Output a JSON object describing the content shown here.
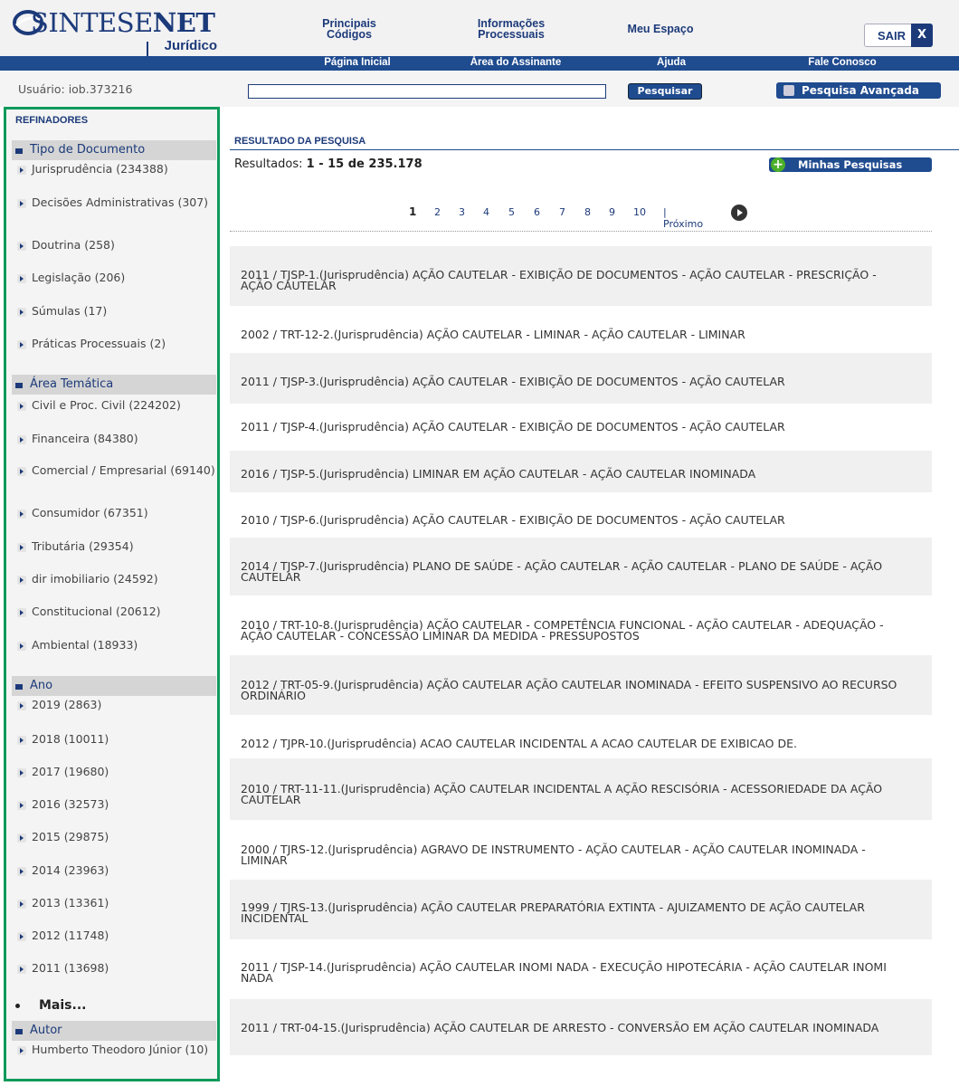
{
  "logo": {
    "brand_a": "SINTESE",
    "brand_b": "NET",
    "sub": "Jurídico"
  },
  "topnav": [
    {
      "label": "Principais Códigos"
    },
    {
      "label": "Informações Processuais"
    },
    {
      "label": "Meu Espaço"
    }
  ],
  "sair": {
    "label": "SAIR",
    "close": "X"
  },
  "subnav": [
    "Página Inicial",
    "Área do Assinante",
    "Ajuda",
    "Fale Conosco"
  ],
  "user": {
    "label": "Usuário: iob.373216"
  },
  "search": {
    "value": "",
    "button": "Pesquisar",
    "advanced": "Pesquisa Avançada"
  },
  "sidebar": {
    "title": "REFINADORES",
    "tipo": {
      "title": "Tipo de Documento",
      "items": [
        "Jurisprudência (234388)",
        "Decisões Administrativas (307)",
        "Doutrina (258)",
        "Legislação (206)",
        "Súmulas (17)",
        "Práticas Processuais (2)"
      ]
    },
    "area": {
      "title": "Área Temática",
      "items": [
        "Civil e Proc. Civil (224202)",
        "Financeira (84380)",
        "Comercial / Empresarial (69140)",
        "Consumidor (67351)",
        "Tributária (29354)",
        "dir imobiliario (24592)",
        "Constitucional (20612)",
        "Ambiental (18933)"
      ]
    },
    "ano": {
      "title": "Ano",
      "items": [
        "2019 (2863)",
        "2018 (10011)",
        "2017 (19680)",
        "2016 (32573)",
        "2015 (29875)",
        "2014 (23963)",
        "2013 (13361)",
        "2012 (11748)",
        "2011 (13698)"
      ]
    },
    "mais": "Mais...",
    "autor": {
      "title": "Autor",
      "items": [
        "Humberto Theodoro Júnior (10)"
      ]
    }
  },
  "results": {
    "title": "RESULTADO DA PESQUISA",
    "count_label": "Resultados:",
    "count_value": "1 - 15 de 235.178",
    "minhas": "Minhas Pesquisas",
    "pages": [
      "1",
      "2",
      "3",
      "4",
      "5",
      "6",
      "7",
      "8",
      "9",
      "10"
    ],
    "next": "| Próximo",
    "items": [
      "2011 / TJSP-1.(Jurisprudência) AÇÃO CAUTELAR - EXIBIÇÃO DE DOCUMENTOS - AÇÃO CAUTELAR - PRESCRIÇÃO - AÇÃO CAUTELAR",
      "2002 / TRT-12-2.(Jurisprudência) AÇÃO CAUTELAR - LIMINAR - AÇÃO CAUTELAR - LIMINAR",
      "2011 / TJSP-3.(Jurisprudência) AÇÃO CAUTELAR - EXIBIÇÃO DE DOCUMENTOS - AÇÃO CAUTELAR",
      "2011 / TJSP-4.(Jurisprudência) AÇÃO CAUTELAR - EXIBIÇÃO DE DOCUMENTOS - AÇÃO CAUTELAR",
      "2016 / TJSP-5.(Jurisprudência) LIMINAR EM AÇÃO CAUTELAR - AÇÃO CAUTELAR INOMINADA",
      "2010 / TJSP-6.(Jurisprudência) AÇÃO CAUTELAR - EXIBIÇÃO DE DOCUMENTOS - AÇÃO CAUTELAR",
      "2014 / TJSP-7.(Jurisprudência) PLANO DE SAÚDE - AÇÃO CAUTELAR - AÇÃO CAUTELAR - PLANO DE SAÚDE - AÇÃO CAUTELAR",
      "2010 / TRT-10-8.(Jurisprudência) AÇÃO CAUTELAR - COMPETÊNCIA FUNCIONAL - AÇÃO CAUTELAR - ADEQUAÇÃO - AÇÃO CAUTELAR - CONCESSÃO LIMINAR DA MEDIDA - PRESSUPOSTOS",
      "2012 / TRT-05-9.(Jurisprudência) AÇÃO CAUTELAR AÇÃO CAUTELAR INOMINADA - EFEITO SUSPENSIVO AO RECURSO ORDINÁRIO",
      "2012 / TJPR-10.(Jurisprudência) ACAO CAUTELAR INCIDENTAL A ACAO CAUTELAR DE EXIBICAO DE.",
      "2010 / TRT-11-11.(Jurisprudência) AÇÃO CAUTELAR INCIDENTAL A AÇÃO RESCISÓRIA - ACESSORIEDADE DA AÇÃO CAUTELAR",
      "2000 / TJRS-12.(Jurisprudência) AGRAVO DE INSTRUMENTO - AÇÃO CAUTELAR - AÇÃO CAUTELAR INOMINADA - LIMINAR",
      "1999 / TJRS-13.(Jurisprudência) AÇÃO CAUTELAR PREPARATÓRIA EXTINTA - AJUIZAMENTO DE AÇÃO CAUTELAR INCIDENTAL",
      "2011 / TJSP-14.(Jurisprudência) AÇÃO CAUTELAR INOMI NADA - EXECUÇÃO HIPOTECÁRIA - AÇÃO CAUTELAR INOMI NADA",
      "2011 / TRT-04-15.(Jurisprudência) AÇÃO CAUTELAR DE ARRESTO - CONVERSÃO EM AÇÃO CAUTELAR INOMINADA"
    ]
  }
}
